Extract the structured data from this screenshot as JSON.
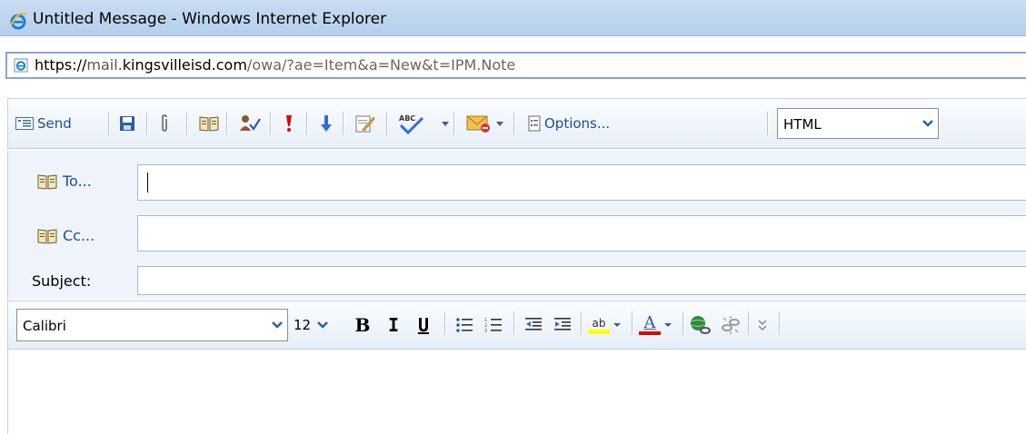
{
  "window": {
    "title": "Untitled Message - Windows Internet Explorer"
  },
  "address": {
    "scheme": "https://",
    "host_prefix": "mail.",
    "host_main": "kingsvilleisd.com",
    "path": "/owa/?ae=Item&a=New&t=IPM.Note"
  },
  "toolbar": {
    "send_label": "Send",
    "options_label": "Options...",
    "format_value": "HTML"
  },
  "recipients": {
    "to_label": "To...",
    "cc_label": "Cc...",
    "subject_label": "Subject:",
    "to_value": "",
    "cc_value": "",
    "subject_value": ""
  },
  "formatting": {
    "font_value": "Calibri",
    "size_value": "12",
    "bold_label": "B",
    "italic_label": "I",
    "underline_label": "U",
    "highlight_label": "ab",
    "font_color_label": "A"
  },
  "colors": {
    "link_blue": "#1d4f91",
    "highlight_yellow": "#ffff00",
    "font_color_red": "#e00000",
    "importance_red": "#e00000"
  }
}
